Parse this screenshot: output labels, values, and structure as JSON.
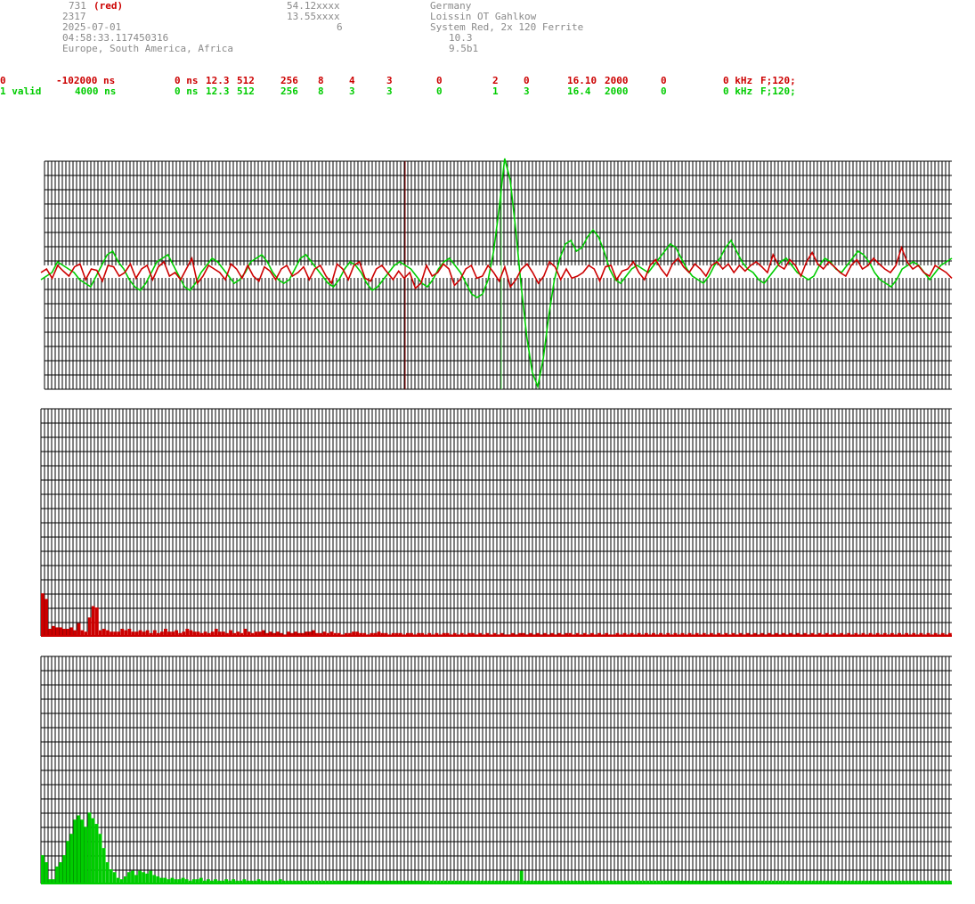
{
  "header": {
    "id_line": "731",
    "id_color": "(red)",
    "number": "2317",
    "date": "2025-07-01",
    "time": "04:58:33.117450316",
    "region": "Europe, South America, Africa",
    "lat": "54.12xxxx",
    "lon": "13.55xxxx",
    "n": "6",
    "country": "Germany",
    "location": "Loissin OT Gahlkow",
    "system": "System Red, 2x 120 Ferrite",
    "v1": "10.3",
    "v2": "9.5b1"
  },
  "params": {
    "red": [
      "0",
      "-102000 ns",
      "0 ns",
      "12.3",
      "512",
      "256",
      "8",
      "4",
      "3",
      "0",
      "2",
      "0",
      "16.10",
      "2000",
      "0",
      "0 kHz",
      "F;120;"
    ],
    "green": [
      "1 valid",
      "4000 ns",
      "0 ns",
      "12.3",
      "512",
      "256",
      "8",
      "3",
      "3",
      "0",
      "1",
      "3",
      "16.4",
      "2000",
      "0",
      "0 kHz",
      "F;120;"
    ]
  },
  "colors": {
    "red": "#cc0000",
    "green": "#00cc00",
    "grid": "#000000",
    "marker_red": "#8b0000"
  },
  "chart_data": [
    {
      "type": "line",
      "series": [
        {
          "values": [
            0.0,
            0.05,
            -0.08,
            0.1,
            0.02,
            -0.05,
            0.08,
            0.12,
            -0.1,
            0.05,
            0.03,
            -0.12,
            0.1,
            0.08,
            -0.05,
            0.0,
            0.12,
            -0.08,
            0.05,
            0.1,
            -0.1,
            0.08,
            0.15,
            -0.05,
            0.0,
            -0.1,
            0.05,
            0.2,
            -0.15,
            -0.05,
            0.1,
            0.05,
            0.0,
            -0.1,
            0.12,
            0.05,
            -0.08,
            0.1,
            -0.05,
            -0.12,
            0.08,
            0.02,
            -0.1,
            0.05,
            0.1,
            -0.05,
            0.0,
            0.08,
            -0.1,
            0.05,
            0.1,
            -0.05,
            -0.15,
            0.12,
            0.05,
            -0.1,
            0.1,
            0.15,
            -0.08,
            -0.12,
            0.05,
            0.1,
            0.0,
            -0.1,
            0.02,
            -0.08,
            0.0,
            -0.22,
            -0.15,
            0.1,
            -0.05,
            0.0,
            0.12,
            0.05,
            -0.18,
            -0.1,
            0.05,
            0.1,
            -0.08,
            -0.05,
            0.1,
            0.0,
            -0.12,
            0.08,
            -0.2,
            -0.1,
            0.05,
            0.12,
            0.0,
            -0.15,
            -0.05,
            0.15,
            0.08,
            -0.1,
            0.05,
            -0.08,
            -0.05,
            0.0,
            0.1,
            0.05,
            -0.12,
            0.08,
            0.1,
            -0.1,
            0.02,
            0.05,
            0.15,
            0.0,
            -0.1,
            0.1,
            0.18,
            0.05,
            -0.05,
            0.12,
            0.2,
            0.08,
            0.0,
            0.12,
            0.05,
            -0.05,
            0.1,
            0.15,
            0.05,
            0.12,
            0.0,
            0.1,
            0.02,
            0.1,
            0.15,
            0.08,
            0.0,
            0.25,
            0.1,
            0.05,
            0.18,
            0.1,
            -0.05,
            0.15,
            0.28,
            0.12,
            0.05,
            0.15,
            0.08,
            0.0,
            -0.05,
            0.1,
            0.18,
            0.05,
            0.1,
            0.2,
            0.12,
            0.05,
            0.0,
            0.1,
            0.35,
            0.15,
            0.05,
            0.1,
            0.0,
            -0.05,
            0.1,
            0.05,
            0.0,
            -0.08
          ]
        },
        {
          "values": [
            -0.1,
            -0.05,
            0.0,
            0.15,
            0.1,
            0.05,
            0.0,
            -0.1,
            -0.15,
            -0.2,
            -0.05,
            0.1,
            0.25,
            0.3,
            0.15,
            0.05,
            -0.1,
            -0.2,
            -0.25,
            -0.15,
            0.0,
            0.15,
            0.2,
            0.25,
            0.1,
            -0.05,
            -0.2,
            -0.25,
            -0.15,
            0.0,
            0.1,
            0.2,
            0.15,
            0.05,
            -0.05,
            -0.15,
            -0.1,
            0.0,
            0.15,
            0.2,
            0.25,
            0.15,
            0.0,
            -0.1,
            -0.15,
            -0.1,
            0.05,
            0.2,
            0.25,
            0.15,
            0.05,
            -0.05,
            -0.15,
            -0.2,
            -0.1,
            0.05,
            0.15,
            0.1,
            0.0,
            -0.15,
            -0.25,
            -0.2,
            -0.1,
            0.0,
            0.1,
            0.15,
            0.1,
            0.05,
            -0.05,
            -0.15,
            -0.2,
            -0.1,
            0.05,
            0.15,
            0.2,
            0.1,
            0.0,
            -0.15,
            -0.3,
            -0.35,
            -0.3,
            -0.1,
            0.3,
            0.9,
            1.6,
            1.3,
            0.6,
            -0.2,
            -0.9,
            -1.4,
            -1.6,
            -1.2,
            -0.6,
            -0.1,
            0.2,
            0.4,
            0.45,
            0.3,
            0.35,
            0.5,
            0.6,
            0.5,
            0.3,
            0.05,
            -0.1,
            -0.15,
            -0.05,
            0.05,
            0.1,
            0.05,
            0.0,
            0.1,
            0.2,
            0.3,
            0.4,
            0.35,
            0.2,
            0.05,
            -0.05,
            -0.1,
            -0.15,
            -0.05,
            0.1,
            0.2,
            0.35,
            0.45,
            0.3,
            0.15,
            0.05,
            0.0,
            -0.1,
            -0.15,
            -0.05,
            0.05,
            0.15,
            0.2,
            0.1,
            0.0,
            -0.05,
            -0.1,
            -0.05,
            0.1,
            0.2,
            0.15,
            0.05,
            0.0,
            0.1,
            0.2,
            0.3,
            0.25,
            0.15,
            0.0,
            -0.1,
            -0.15,
            -0.2,
            -0.1,
            0.05,
            0.1,
            0.15,
            0.1,
            0.0,
            -0.1,
            0.0,
            0.1,
            0.15,
            0.2
          ]
        }
      ],
      "ylim": [
        -2,
        2
      ]
    },
    {
      "type": "bar",
      "values": [
        3.0,
        2.6,
        0.5,
        0.7,
        0.6,
        0.6,
        0.5,
        0.5,
        0.6,
        0.4,
        0.9,
        0.4,
        0.3,
        1.3,
        2.1,
        2.0,
        0.4,
        0.5,
        0.4,
        0.3,
        0.3,
        0.3,
        0.5,
        0.4,
        0.5,
        0.3,
        0.3,
        0.4,
        0.3,
        0.4,
        0.2,
        0.4,
        0.2,
        0.3,
        0.5,
        0.3,
        0.3,
        0.4,
        0.2,
        0.3,
        0.5,
        0.4,
        0.3,
        0.3,
        0.2,
        0.3,
        0.2,
        0.3,
        0.5,
        0.3,
        0.3,
        0.2,
        0.4,
        0.2,
        0.3,
        0.2,
        0.5,
        0.3,
        0.2,
        0.3,
        0.3,
        0.4,
        0.2,
        0.3,
        0.2,
        0.3,
        0.2,
        0.1,
        0.3,
        0.2,
        0.3,
        0.2,
        0.2,
        0.3,
        0.3,
        0.4,
        0.2,
        0.2,
        0.3,
        0.2,
        0.3,
        0.2,
        0.2,
        0.1,
        0.2,
        0.2,
        0.3,
        0.3,
        0.2,
        0.2,
        0.1,
        0.2,
        0.2,
        0.3,
        0.2,
        0.2,
        0.1,
        0.2,
        0.2,
        0.2,
        0.1,
        0.2,
        0.2,
        0.1,
        0.2,
        0.2,
        0.1,
        0.2,
        0.1,
        0.2,
        0.1,
        0.2,
        0.2,
        0.1,
        0.2,
        0.1,
        0.2,
        0.1,
        0.2,
        0.2,
        0.1,
        0.2,
        0.1,
        0.2,
        0.1,
        0.2,
        0.1,
        0.2,
        0.1,
        0.1,
        0.2,
        0.1,
        0.2,
        0.2,
        0.1,
        0.2,
        0.1,
        0.2,
        0.1,
        0.2,
        0.1,
        0.2,
        0.1,
        0.2,
        0.1,
        0.2,
        0.2,
        0.1,
        0.2,
        0.1,
        0.2,
        0.1,
        0.2,
        0.1,
        0.2,
        0.1,
        0.2,
        0.1,
        0.1,
        0.2,
        0.1,
        0.2,
        0.1,
        0.2,
        0.1,
        0.2,
        0.1,
        0.2,
        0.1,
        0.2,
        0.1,
        0.2,
        0.1,
        0.2,
        0.1,
        0.2,
        0.1,
        0.2,
        0.1,
        0.2,
        0.1,
        0.2,
        0.1,
        0.2,
        0.1,
        0.2,
        0.1,
        0.2,
        0.1,
        0.2,
        0.1,
        0.2,
        0.1,
        0.2,
        0.1,
        0.2,
        0.1,
        0.2,
        0.1,
        0.2,
        0.1,
        0.2,
        0.1,
        0.2,
        0.1,
        0.2,
        0.1,
        0.2,
        0.1,
        0.2,
        0.1,
        0.2,
        0.1,
        0.2,
        0.1,
        0.2,
        0.1,
        0.2,
        0.1,
        0.2,
        0.1,
        0.2,
        0.1,
        0.2,
        0.1,
        0.2,
        0.1,
        0.2,
        0.1,
        0.2,
        0.1,
        0.2,
        0.1,
        0.2,
        0.1,
        0.2,
        0.1,
        0.2,
        0.1,
        0.2,
        0.1,
        0.2,
        0.1,
        0.2,
        0.1,
        0.2,
        0.1,
        0.2,
        0.1,
        0.2,
        0.1,
        0.2
      ],
      "ylim": [
        0,
        16
      ]
    },
    {
      "type": "bar",
      "values": [
        2.0,
        1.5,
        0.3,
        0.3,
        1.2,
        1.5,
        2.0,
        3.0,
        3.5,
        4.5,
        4.8,
        4.5,
        4.0,
        5.0,
        4.6,
        4.2,
        3.5,
        2.5,
        1.5,
        1.0,
        0.8,
        0.4,
        0.3,
        0.5,
        0.8,
        0.9,
        0.6,
        0.9,
        0.8,
        0.7,
        0.9,
        0.6,
        0.5,
        0.4,
        0.4,
        0.3,
        0.4,
        0.3,
        0.3,
        0.4,
        0.3,
        0.2,
        0.3,
        0.3,
        0.4,
        0.2,
        0.3,
        0.2,
        0.3,
        0.2,
        0.2,
        0.3,
        0.2,
        0.3,
        0.2,
        0.2,
        0.3,
        0.2,
        0.2,
        0.2,
        0.3,
        0.2,
        0.2,
        0.2,
        0.2,
        0.2,
        0.3,
        0.2,
        0.2,
        0.2,
        0.2,
        0.2,
        0.2,
        0.2,
        0.2,
        0.2,
        0.2,
        0.2,
        0.2,
        0.2,
        0.2,
        0.2,
        0.2,
        0.2,
        0.2,
        0.2,
        0.2,
        0.2,
        0.2,
        0.2,
        0.2,
        0.2,
        0.2,
        0.2,
        0.2,
        0.2,
        0.2,
        0.2,
        0.2,
        0.2,
        0.2,
        0.2,
        0.2,
        0.2,
        0.2,
        0.2,
        0.2,
        0.2,
        0.2,
        0.2,
        0.2,
        0.2,
        0.2,
        0.2,
        0.2,
        0.2,
        0.2,
        0.2,
        0.2,
        0.2,
        0.2,
        0.2,
        0.2,
        0.2,
        0.2,
        0.2,
        0.2,
        0.2,
        0.2,
        0.2,
        0.2,
        0.2,
        0.2,
        0.9,
        0.2,
        0.2,
        0.2,
        0.2,
        0.2,
        0.2,
        0.2,
        0.2,
        0.2,
        0.2,
        0.2,
        0.2,
        0.2,
        0.2,
        0.2,
        0.2,
        0.2,
        0.2,
        0.2,
        0.2,
        0.2,
        0.2,
        0.2,
        0.2,
        0.2,
        0.2,
        0.2,
        0.2,
        0.2,
        0.2,
        0.2,
        0.2,
        0.2,
        0.2,
        0.2,
        0.2,
        0.2,
        0.2,
        0.2,
        0.2,
        0.2,
        0.2,
        0.2,
        0.2,
        0.2,
        0.2,
        0.2,
        0.2,
        0.2,
        0.2,
        0.2,
        0.2,
        0.2,
        0.2,
        0.2,
        0.2,
        0.2,
        0.2,
        0.2,
        0.2,
        0.2,
        0.2,
        0.2,
        0.2,
        0.2,
        0.2,
        0.2,
        0.2,
        0.2,
        0.2,
        0.2,
        0.2,
        0.2,
        0.2,
        0.2,
        0.2,
        0.2,
        0.2,
        0.2,
        0.2,
        0.2,
        0.2,
        0.2,
        0.2,
        0.2,
        0.2,
        0.2,
        0.2,
        0.2,
        0.2,
        0.2,
        0.2,
        0.2,
        0.2,
        0.2,
        0.2,
        0.2,
        0.2,
        0.2,
        0.2,
        0.2,
        0.2,
        0.2,
        0.2,
        0.2,
        0.2,
        0.2,
        0.2,
        0.2,
        0.2,
        0.2,
        0.2,
        0.2,
        0.2,
        0.2,
        0.2,
        0.2,
        0.2,
        0.2
      ],
      "ylim": [
        0,
        16
      ]
    }
  ]
}
